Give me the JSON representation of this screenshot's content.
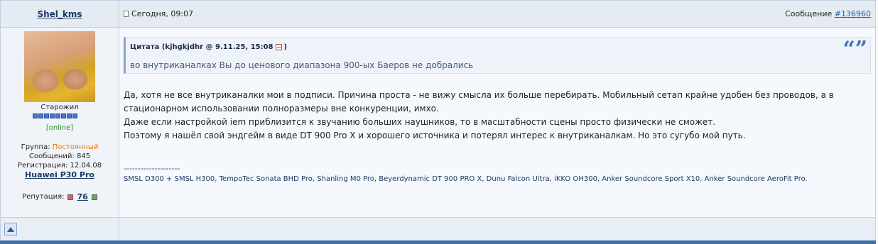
{
  "post": {
    "username": "Shel_kms",
    "date": "Сегодня, 09:07",
    "message_label": "Сообщение",
    "message_number": "#136960"
  },
  "user": {
    "rank": "Старожил",
    "rank_pips": 8,
    "status": "[online]",
    "group_label": "Группа:",
    "group_value": "Постоянный",
    "messages_label": "Сообщений:",
    "messages_value": "845",
    "registered_label": "Регистрация:",
    "registered_value": "12.04.08",
    "device": "Huawei P30 Pro",
    "reputation_label": "Репутация:",
    "reputation_value": "76"
  },
  "quote": {
    "header": "Цитата (kjhgkjdhr @ 9.11.25, 15:08",
    "header_close": ")",
    "text": "во внутриканалках Вы до ценового диапазона 900-ых Баеров не добрались",
    "mark": "“”"
  },
  "body": {
    "lines": [
      "Да, хотя не все внутриканалки мои в подписи. Причина проста - не вижу смысла их больше перебирать. Мобильный сетап крайне удобен без проводов, а в",
      "стационарном использовании полноразмеры вне конкуренции, имхо.",
      "Даже если настройкой iem приблизится к звучанию больших наушников, то в масштабности сцены просто физически не сможет.",
      "Поэтому я нашёл свой эндгейм в виде DT 900 Pro X и хорошего источника и потерял интерес к внутриканалкам. Но это сугубо мой путь."
    ]
  },
  "signature": {
    "separator": "--------------------",
    "text": "SMSL D300 + SMSL H300, TempoTec Sonata BHD Pro, Shanling M0 Pro, Beyerdynamic DT 900 PRO X, Dunu Falcon Ultra, iKKO OH300, Anker Soundcore Sport X10, Anker Soundcore AeroFit Pro."
  },
  "icons": {
    "post_date": "document-icon",
    "quote_link": "quote-link-icon",
    "scroll_top": "arrow-up-icon"
  },
  "colors": {
    "accent": "#1f5fa8",
    "group": "#e07c10",
    "online": "#2f8f2f"
  }
}
